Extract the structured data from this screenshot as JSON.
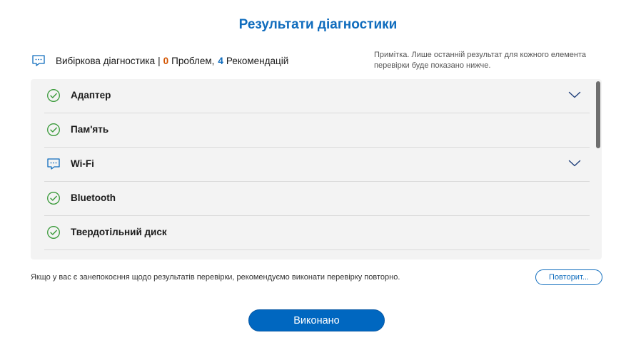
{
  "title": "Результати діагностики",
  "summary": {
    "icon": "chat-recommendation-icon",
    "label": "Вибіркова діагностика",
    "separator": "|",
    "problems_count": "0",
    "problems_label": "Проблем,",
    "recommendations_count": "4",
    "recommendations_label": "Рекомендацій"
  },
  "note": "Примітка. Лише останній результат для кожного елемента перевірки буде показано нижче.",
  "items": [
    {
      "label": "Адаптер",
      "status": "ok",
      "icon": "check-circle-icon",
      "expandable": true
    },
    {
      "label": "Пам'ять",
      "status": "ok",
      "icon": "check-circle-icon",
      "expandable": false
    },
    {
      "label": "Wi-Fi",
      "status": "recommendation",
      "icon": "chat-recommendation-icon",
      "expandable": true
    },
    {
      "label": "Bluetooth",
      "status": "ok",
      "icon": "check-circle-icon",
      "expandable": false
    },
    {
      "label": "Твердотільний диск",
      "status": "ok",
      "icon": "check-circle-icon",
      "expandable": false
    }
  ],
  "footer": {
    "text": "Якщо у вас є занепокоєння щодо результатів перевірки, рекомендуємо виконати перевірку повторно.",
    "retry_label": "Повторит..."
  },
  "done_label": "Виконано",
  "colors": {
    "accent": "#0f6cbd",
    "ok": "#3a9a3a",
    "problems": "#d35400"
  }
}
